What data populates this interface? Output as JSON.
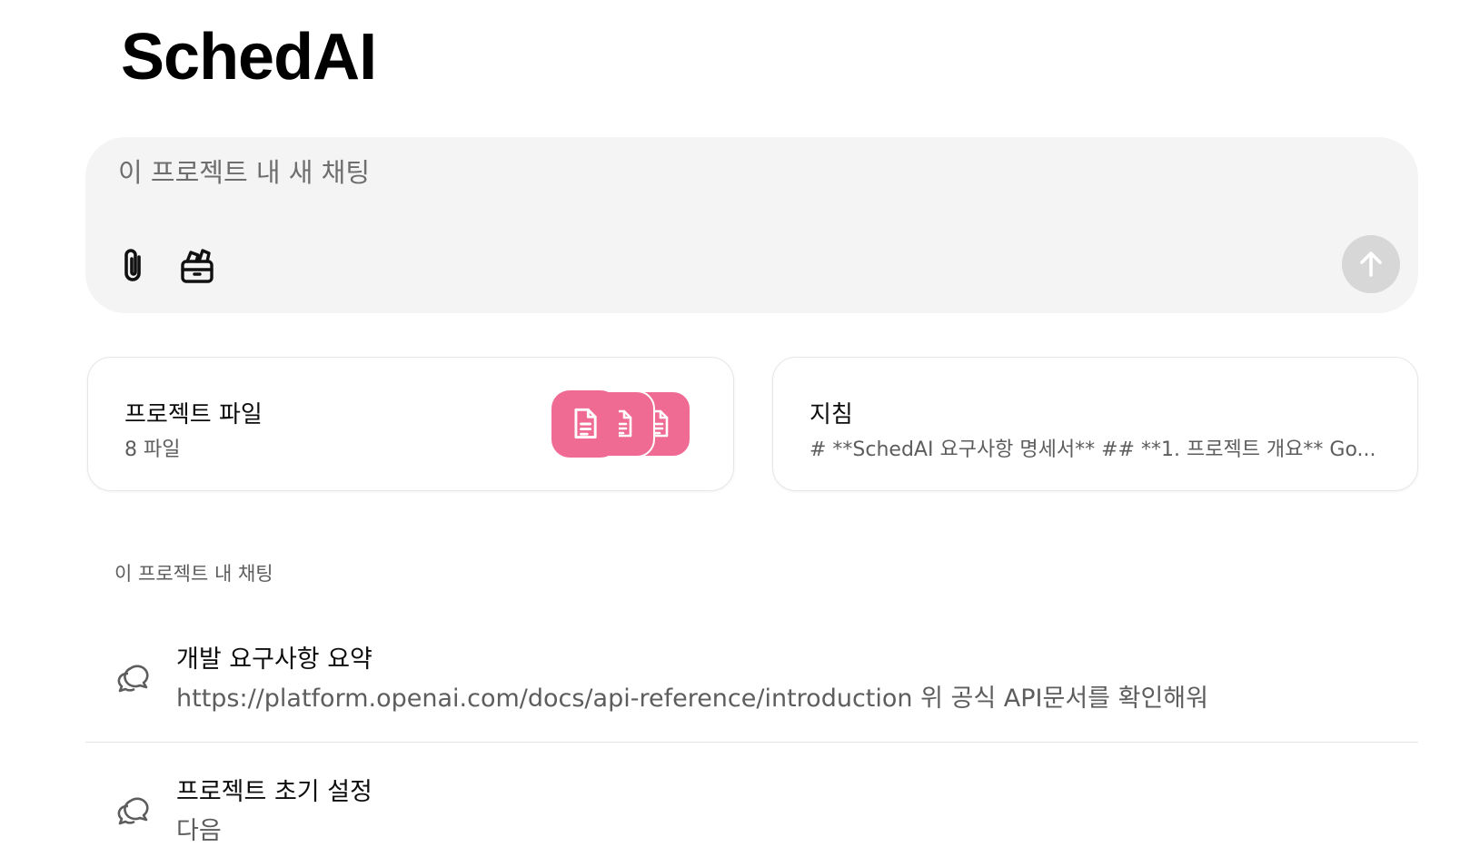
{
  "project": {
    "title": "SchedAI"
  },
  "composer": {
    "placeholder": "이 프로젝트 내 새 채팅",
    "attach_icon": "paperclip-icon",
    "project_icon": "folder-box-icon",
    "send_icon": "arrow-up-icon"
  },
  "cards": {
    "files": {
      "title": "프로젝트 파일",
      "subtitle": "8 파일",
      "icon_color": "#ef6b93",
      "icon": "document-icon"
    },
    "instructions": {
      "title": "지침",
      "preview": "# **SchedAI 요구사항 명세서** ## **1. 프로젝트 개요** Go..."
    }
  },
  "chats_section": {
    "label": "이 프로젝트 내 채팅"
  },
  "chats": [
    {
      "title": "개발 요구사항 요약",
      "preview": "https://platform.openai.com/docs/api-reference/introduction 위 공식 API문서를 확인해워",
      "icon": "chat-bubbles-icon"
    },
    {
      "title": "프로젝트 초기 설정",
      "preview": "다음",
      "icon": "chat-bubbles-icon"
    }
  ],
  "colors": {
    "accent": "#ef6b93",
    "composer_bg": "#f4f4f4",
    "send_disabled": "#d7d7d7"
  }
}
